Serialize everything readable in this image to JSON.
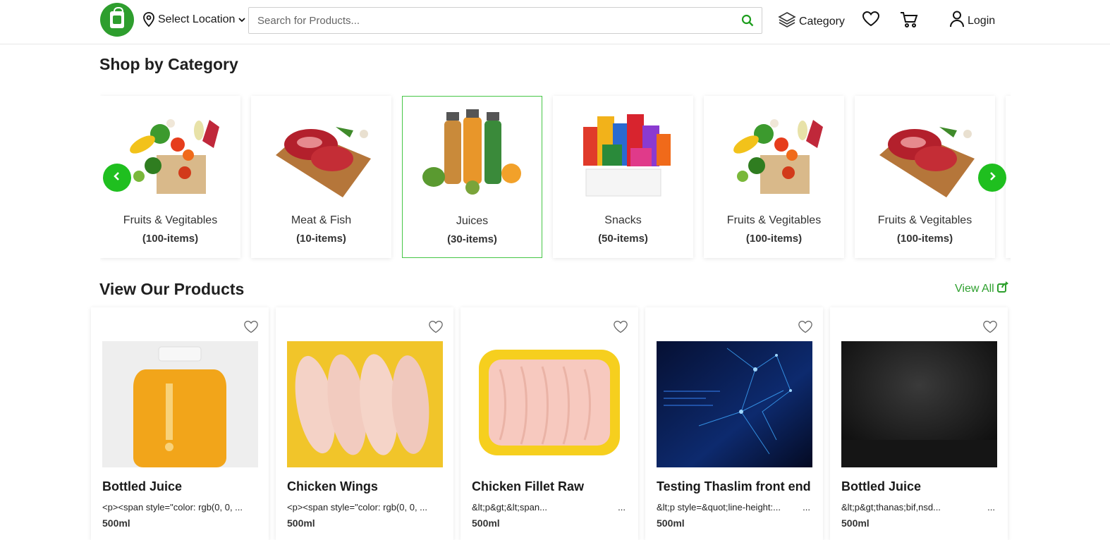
{
  "header": {
    "location_label": "Select Location",
    "search_placeholder": "Search for Products...",
    "category_label": "Category",
    "login_label": "Login"
  },
  "colors": {
    "brand_green": "#2ea02e",
    "arrow_green": "#1fbf1f",
    "active_border": "#46c646"
  },
  "sections": {
    "category_title": "Shop by Category",
    "products_title": "View Our Products",
    "view_all_label": "View All"
  },
  "categories": [
    {
      "name": "Fruits & Vegitables",
      "count": "(100-items)",
      "image": "produce-bag"
    },
    {
      "name": "Meat & Fish",
      "count": "(10-items)",
      "image": "meat-board"
    },
    {
      "name": "Juices",
      "count": "(30-items)",
      "image": "juice-bottles",
      "selected": true
    },
    {
      "name": "Snacks",
      "count": "(50-items)",
      "image": "snack-box"
    },
    {
      "name": "Fruits & Vegitables",
      "count": "(100-items)",
      "image": "produce-bag"
    },
    {
      "name": "Fruits & Vegitables",
      "count": "(100-items)",
      "image": "meat-board"
    }
  ],
  "products": [
    {
      "name": "Bottled Juice",
      "desc": "<p><span style=\"color: rgb(0, 0, ...",
      "desc_more": "",
      "unit": "500ml",
      "image": "juice-jar"
    },
    {
      "name": "Chicken Wings",
      "desc": "<p><span style=\"color: rgb(0, 0, ...",
      "desc_more": "",
      "unit": "500ml",
      "image": "chicken-wings"
    },
    {
      "name": "Chicken Fillet Raw",
      "desc": "&lt;p&gt;&lt;span...",
      "desc_more": "...",
      "unit": "500ml",
      "image": "chicken-fillet"
    },
    {
      "name": "Testing Thaslim front end",
      "desc": "&lt;p style=&quot;line-height:...",
      "desc_more": "...",
      "unit": "500ml",
      "image": "tech-network"
    },
    {
      "name": "Bottled Juice",
      "desc": "&lt;p&gt;thanas;bif,nsd...",
      "desc_more": "...",
      "unit": "500ml",
      "image": "dark-texture"
    }
  ]
}
